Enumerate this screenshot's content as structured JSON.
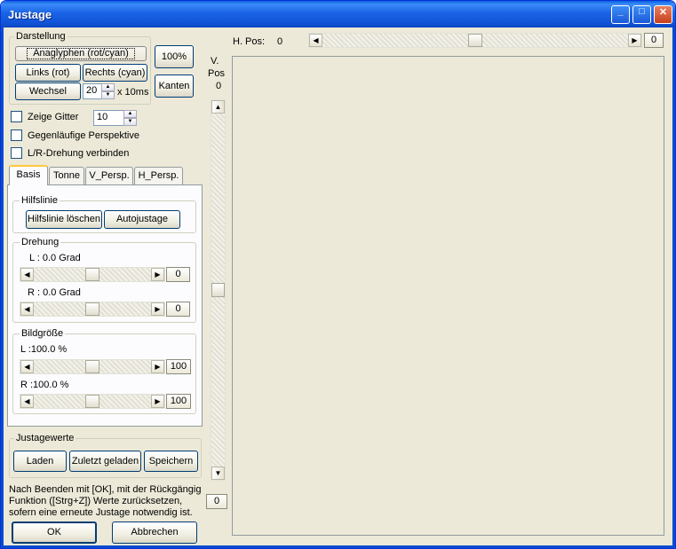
{
  "window": {
    "title": "Justage"
  },
  "darstellung": {
    "label": "Darstellung",
    "anaglyph_btn": "Anaglyphen (rot/cyan)",
    "zoom_btn": "100%",
    "links_btn": "Links (rot)",
    "rechts_btn": "Rechts (cyan)",
    "kanten_btn": "Kanten",
    "wechsel_btn": "Wechsel",
    "interval_value": "20",
    "interval_unit": "x 10ms"
  },
  "options": {
    "grid_label": "Zeige Gitter",
    "grid_value": "10",
    "perspective_label": "Gegenläufige Perspektive",
    "rotation_label": "L/R-Drehung verbinden"
  },
  "tabs": [
    "Basis",
    "Tonne",
    "V_Persp.",
    "H_Persp."
  ],
  "basis": {
    "hilfslinie_label": "Hilfslinie",
    "clear_btn": "Hilfslinie löschen",
    "auto_btn": "Autojustage",
    "drehung_label": "Drehung",
    "rot_l_text": "L : 0.0 Grad",
    "rot_l_value": "0",
    "rot_l_fraction": 0.5,
    "rot_r_text": "R : 0.0 Grad",
    "rot_r_value": "0",
    "rot_r_fraction": 0.5,
    "size_label": "Bildgröße",
    "size_l_text": "L :100.0 %",
    "size_l_value": "100",
    "size_l_fraction": 0.5,
    "size_r_text": "R :100.0 %",
    "size_r_value": "100",
    "size_r_fraction": 0.5
  },
  "werte": {
    "label": "Justagewerte",
    "laden_btn": "Laden",
    "zuletzt_btn": "Zuletzt geladen",
    "speichern_btn": "Speichern"
  },
  "note": {
    "line1": "Nach Beenden mit [OK], mit der Rückgängig",
    "line2": "Funktion ([Strg+Z]) Werte zurücksetzen,",
    "line3": "sofern eine erneute Justage notwendig ist."
  },
  "footer": {
    "ok_btn": "OK",
    "cancel_btn": "Abbrechen"
  },
  "hpos": {
    "label": "H. Pos:",
    "value_text": "0",
    "box_value": "0",
    "fraction": 0.5
  },
  "vpos": {
    "label_1": "V.",
    "label_2": "Pos",
    "value_text": "0",
    "box_value": "0",
    "fraction": 0.5
  }
}
